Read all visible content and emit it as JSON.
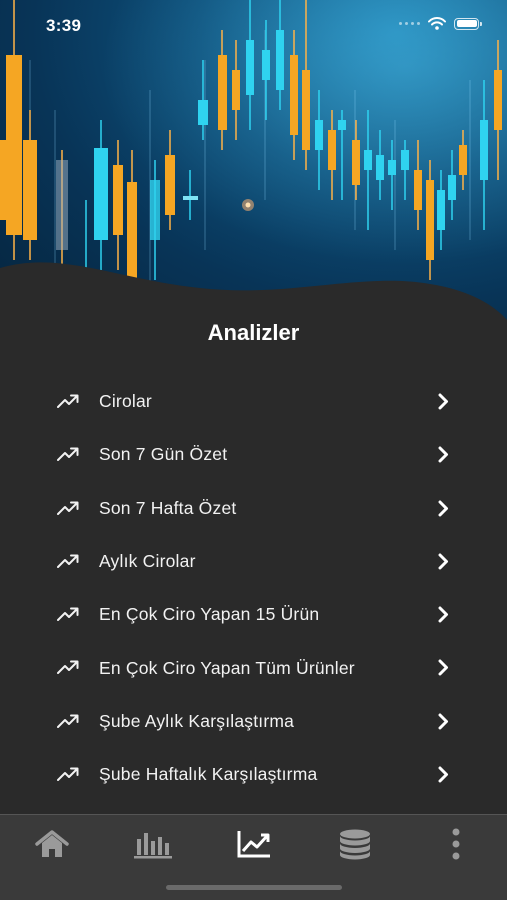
{
  "status_bar": {
    "time": "3:39"
  },
  "page_title": "Analizler",
  "menu": {
    "items": [
      {
        "label": "Cirolar",
        "icon": "trending-up-icon"
      },
      {
        "label": "Son 7 Gün Özet",
        "icon": "trending-up-icon"
      },
      {
        "label": "Son 7 Hafta Özet",
        "icon": "trending-up-icon"
      },
      {
        "label": "Aylık Cirolar",
        "icon": "trending-up-icon"
      },
      {
        "label": "En Çok Ciro Yapan 15 Ürün",
        "icon": "trending-up-icon"
      },
      {
        "label": "En Çok Ciro Yapan Tüm Ürünler",
        "icon": "trending-up-icon"
      },
      {
        "label": "Şube Aylık Karşılaştırma",
        "icon": "trending-up-icon"
      },
      {
        "label": "Şube Haftalık Karşılaştırma",
        "icon": "trending-up-icon"
      }
    ]
  },
  "tab_bar": {
    "tabs": [
      {
        "icon": "home-icon",
        "active": false
      },
      {
        "icon": "bar-chart-icon",
        "active": false
      },
      {
        "icon": "trending-up-icon",
        "active": true
      },
      {
        "icon": "database-icon",
        "active": false
      },
      {
        "icon": "more-vertical-icon",
        "active": false
      }
    ]
  },
  "colors": {
    "background": "#2a2a2a",
    "tabbar": "#3a3a3a",
    "candle_orange": "#f5a623",
    "candle_cyan": "#2fd3f0",
    "hero_blue": "#0d4f7a",
    "icon_inactive": "#9a9a9a",
    "icon_active": "#ffffff"
  }
}
